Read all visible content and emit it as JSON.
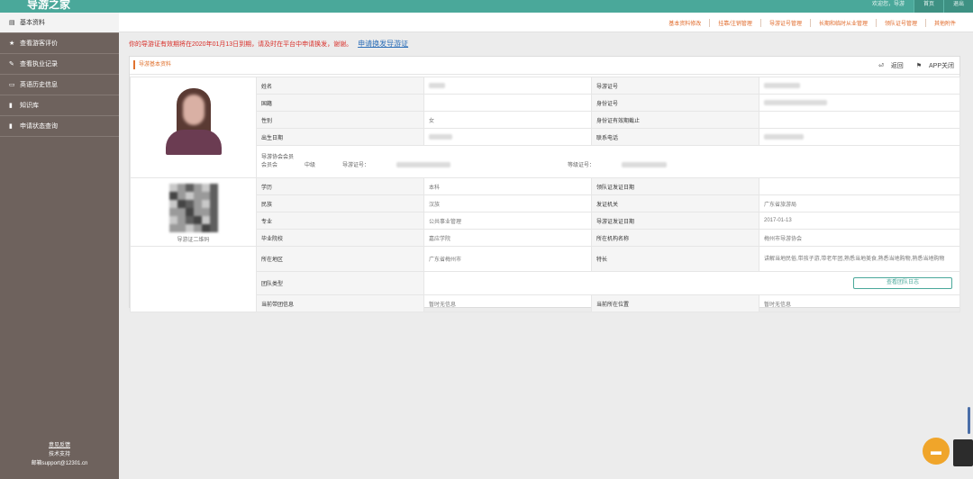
{
  "app": {
    "title": "导游之家"
  },
  "topbar": {
    "right_items": [
      "欢迎您，导游",
      "首页",
      "退出"
    ]
  },
  "sidebar": {
    "items": [
      {
        "icon": "doc-icon",
        "label": "基本资料",
        "active": true
      },
      {
        "icon": "star-icon",
        "label": "查看游客评价",
        "active": false
      },
      {
        "icon": "edit-icon",
        "label": "查看执业记录",
        "active": false
      },
      {
        "icon": "card-icon",
        "label": "英语历史信息",
        "active": false
      },
      {
        "icon": "book-icon",
        "label": "知识库",
        "active": false
      },
      {
        "icon": "book-icon",
        "label": "申请状态查询",
        "active": false
      }
    ],
    "footer": {
      "link": "意见反馈",
      "support": "技术支持",
      "email": "邮箱support@12301.cn"
    }
  },
  "subnav": {
    "links": [
      "基本资料修改",
      "挂靠/注销管理",
      "导游证号管理",
      "长期和临时从业管理",
      "领队证号管理",
      "其他附件"
    ]
  },
  "notice": {
    "text": "你的导游证有效期将在2020年01月13日到期，请及时在平台中申请换发，谢谢。",
    "link": "申请换发导游证"
  },
  "panel": {
    "title": "导游基本资料",
    "actions": {
      "return": "返回",
      "app_close": "APP关闭"
    },
    "fields": {
      "name_label": "姓名",
      "guide_no_label": "导游证号",
      "nationality_label": "国籍",
      "id_no_label": "身份证号",
      "gender_label": "性别",
      "gender_value": "女",
      "id_valid_label": "身份证有效期截止",
      "birth_label": "出生日期",
      "phone_label": "联系电话",
      "assoc_label": "导游协会会员",
      "assoc_sub1": "会员会",
      "assoc_sub2": "中级",
      "assoc_card_label": "导游证号：",
      "assoc_work_label": "等级证号：",
      "education_label": "学历",
      "education_value": "本科",
      "leader_date_label": "领队证发证日期",
      "ethnicity_label": "民族",
      "ethnicity_value": "汉族",
      "issuer_label": "发证机关",
      "issuer_value": "广东省旅游局",
      "major_label": "专业",
      "major_value": "公共事业管理",
      "issue_date_label": "导游证发证日期",
      "issue_date_value": "2017-01-13",
      "school_label": "毕业院校",
      "school_value": "嘉应学院",
      "agency_label": "所在机构名称",
      "agency_value": "梅州市导游协会",
      "region_label": "所在地区",
      "region_value": "广东省梅州市",
      "specialty_label": "特长",
      "specialty_value": "讲解当地民俗,带孩子游,带老年团,熟悉当地美食,熟悉当地购物,熟悉当地购物",
      "team_type_label": "团队类型",
      "team_log_button": "查看团队日志",
      "current_team_label": "当前带团信息",
      "current_team_value": "暂时无信息",
      "current_pos_label": "当前所在位置",
      "current_pos_value": "暂时无信息",
      "qr_caption": "导游证二维码"
    }
  },
  "chat": {
    "icon": "chat-icon"
  }
}
